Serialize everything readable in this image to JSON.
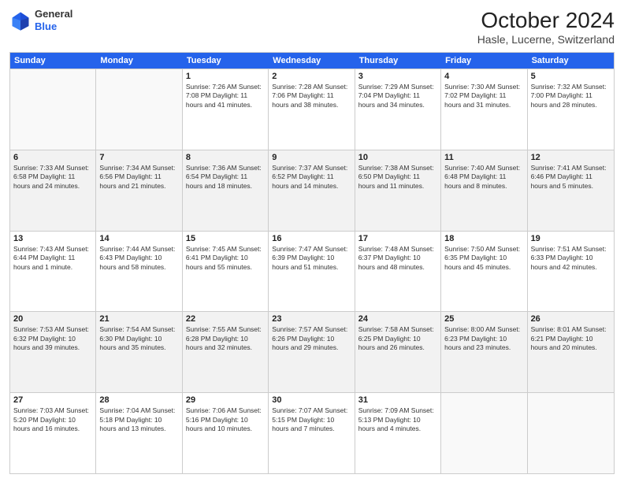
{
  "header": {
    "logo": {
      "general": "General",
      "blue": "Blue"
    },
    "title": "October 2024",
    "location": "Hasle, Lucerne, Switzerland"
  },
  "calendar": {
    "days": [
      "Sunday",
      "Monday",
      "Tuesday",
      "Wednesday",
      "Thursday",
      "Friday",
      "Saturday"
    ],
    "rows": [
      [
        {
          "day": "",
          "info": ""
        },
        {
          "day": "",
          "info": ""
        },
        {
          "day": "1",
          "info": "Sunrise: 7:26 AM\nSunset: 7:08 PM\nDaylight: 11 hours and 41 minutes."
        },
        {
          "day": "2",
          "info": "Sunrise: 7:28 AM\nSunset: 7:06 PM\nDaylight: 11 hours and 38 minutes."
        },
        {
          "day": "3",
          "info": "Sunrise: 7:29 AM\nSunset: 7:04 PM\nDaylight: 11 hours and 34 minutes."
        },
        {
          "day": "4",
          "info": "Sunrise: 7:30 AM\nSunset: 7:02 PM\nDaylight: 11 hours and 31 minutes."
        },
        {
          "day": "5",
          "info": "Sunrise: 7:32 AM\nSunset: 7:00 PM\nDaylight: 11 hours and 28 minutes."
        }
      ],
      [
        {
          "day": "6",
          "info": "Sunrise: 7:33 AM\nSunset: 6:58 PM\nDaylight: 11 hours and 24 minutes."
        },
        {
          "day": "7",
          "info": "Sunrise: 7:34 AM\nSunset: 6:56 PM\nDaylight: 11 hours and 21 minutes."
        },
        {
          "day": "8",
          "info": "Sunrise: 7:36 AM\nSunset: 6:54 PM\nDaylight: 11 hours and 18 minutes."
        },
        {
          "day": "9",
          "info": "Sunrise: 7:37 AM\nSunset: 6:52 PM\nDaylight: 11 hours and 14 minutes."
        },
        {
          "day": "10",
          "info": "Sunrise: 7:38 AM\nSunset: 6:50 PM\nDaylight: 11 hours and 11 minutes."
        },
        {
          "day": "11",
          "info": "Sunrise: 7:40 AM\nSunset: 6:48 PM\nDaylight: 11 hours and 8 minutes."
        },
        {
          "day": "12",
          "info": "Sunrise: 7:41 AM\nSunset: 6:46 PM\nDaylight: 11 hours and 5 minutes."
        }
      ],
      [
        {
          "day": "13",
          "info": "Sunrise: 7:43 AM\nSunset: 6:44 PM\nDaylight: 11 hours and 1 minute."
        },
        {
          "day": "14",
          "info": "Sunrise: 7:44 AM\nSunset: 6:43 PM\nDaylight: 10 hours and 58 minutes."
        },
        {
          "day": "15",
          "info": "Sunrise: 7:45 AM\nSunset: 6:41 PM\nDaylight: 10 hours and 55 minutes."
        },
        {
          "day": "16",
          "info": "Sunrise: 7:47 AM\nSunset: 6:39 PM\nDaylight: 10 hours and 51 minutes."
        },
        {
          "day": "17",
          "info": "Sunrise: 7:48 AM\nSunset: 6:37 PM\nDaylight: 10 hours and 48 minutes."
        },
        {
          "day": "18",
          "info": "Sunrise: 7:50 AM\nSunset: 6:35 PM\nDaylight: 10 hours and 45 minutes."
        },
        {
          "day": "19",
          "info": "Sunrise: 7:51 AM\nSunset: 6:33 PM\nDaylight: 10 hours and 42 minutes."
        }
      ],
      [
        {
          "day": "20",
          "info": "Sunrise: 7:53 AM\nSunset: 6:32 PM\nDaylight: 10 hours and 39 minutes."
        },
        {
          "day": "21",
          "info": "Sunrise: 7:54 AM\nSunset: 6:30 PM\nDaylight: 10 hours and 35 minutes."
        },
        {
          "day": "22",
          "info": "Sunrise: 7:55 AM\nSunset: 6:28 PM\nDaylight: 10 hours and 32 minutes."
        },
        {
          "day": "23",
          "info": "Sunrise: 7:57 AM\nSunset: 6:26 PM\nDaylight: 10 hours and 29 minutes."
        },
        {
          "day": "24",
          "info": "Sunrise: 7:58 AM\nSunset: 6:25 PM\nDaylight: 10 hours and 26 minutes."
        },
        {
          "day": "25",
          "info": "Sunrise: 8:00 AM\nSunset: 6:23 PM\nDaylight: 10 hours and 23 minutes."
        },
        {
          "day": "26",
          "info": "Sunrise: 8:01 AM\nSunset: 6:21 PM\nDaylight: 10 hours and 20 minutes."
        }
      ],
      [
        {
          "day": "27",
          "info": "Sunrise: 7:03 AM\nSunset: 5:20 PM\nDaylight: 10 hours and 16 minutes."
        },
        {
          "day": "28",
          "info": "Sunrise: 7:04 AM\nSunset: 5:18 PM\nDaylight: 10 hours and 13 minutes."
        },
        {
          "day": "29",
          "info": "Sunrise: 7:06 AM\nSunset: 5:16 PM\nDaylight: 10 hours and 10 minutes."
        },
        {
          "day": "30",
          "info": "Sunrise: 7:07 AM\nSunset: 5:15 PM\nDaylight: 10 hours and 7 minutes."
        },
        {
          "day": "31",
          "info": "Sunrise: 7:09 AM\nSunset: 5:13 PM\nDaylight: 10 hours and 4 minutes."
        },
        {
          "day": "",
          "info": ""
        },
        {
          "day": "",
          "info": ""
        }
      ]
    ]
  }
}
